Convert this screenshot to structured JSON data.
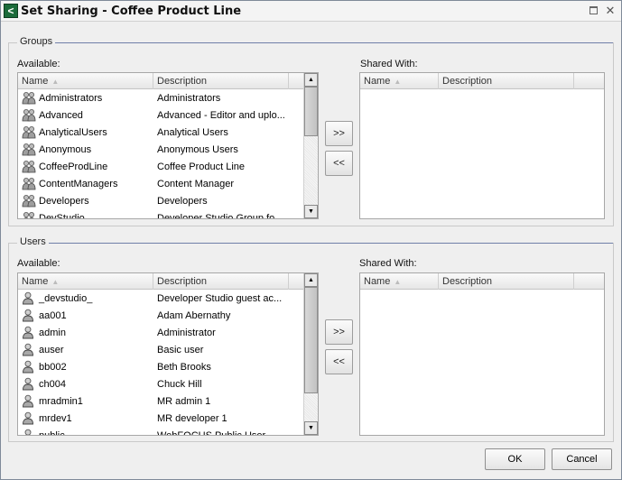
{
  "window": {
    "title": "Set Sharing - Coffee Product Line",
    "maximize_icon": "maximize-icon",
    "close_glyph": "✕"
  },
  "groups": {
    "legend": "Groups",
    "available_label": "Available:",
    "shared_label": "Shared With:",
    "columns": {
      "name": "Name",
      "description": "Description"
    },
    "available_rows": [
      {
        "name": "Administrators",
        "description": "Administrators"
      },
      {
        "name": "Advanced",
        "description": "Advanced - Editor and uplo..."
      },
      {
        "name": "AnalyticalUsers",
        "description": "Analytical Users"
      },
      {
        "name": "Anonymous",
        "description": "Anonymous Users"
      },
      {
        "name": "CoffeeProdLine",
        "description": "Coffee Product Line"
      },
      {
        "name": "ContentManagers",
        "description": "Content Manager"
      },
      {
        "name": "Developers",
        "description": "Developers"
      },
      {
        "name": "DevStudio",
        "description": "Developer Studio Group fo..."
      }
    ],
    "add_label": ">>",
    "remove_label": "<<"
  },
  "users": {
    "legend": "Users",
    "available_label": "Available:",
    "shared_label": "Shared With:",
    "columns": {
      "name": "Name",
      "description": "Description"
    },
    "available_rows": [
      {
        "name": "_devstudio_",
        "description": "Developer Studio guest ac..."
      },
      {
        "name": "aa001",
        "description": "Adam Abernathy"
      },
      {
        "name": "admin",
        "description": "Administrator"
      },
      {
        "name": "auser",
        "description": "Basic user"
      },
      {
        "name": "bb002",
        "description": "Beth Brooks"
      },
      {
        "name": "ch004",
        "description": "Chuck Hill"
      },
      {
        "name": "mradmin1",
        "description": "MR admin 1"
      },
      {
        "name": "mrdev1",
        "description": "MR developer 1"
      },
      {
        "name": "public",
        "description": "WebFOCUS Public User"
      }
    ],
    "add_label": ">>",
    "remove_label": "<<"
  },
  "footer": {
    "ok_label": "OK",
    "cancel_label": "Cancel"
  }
}
